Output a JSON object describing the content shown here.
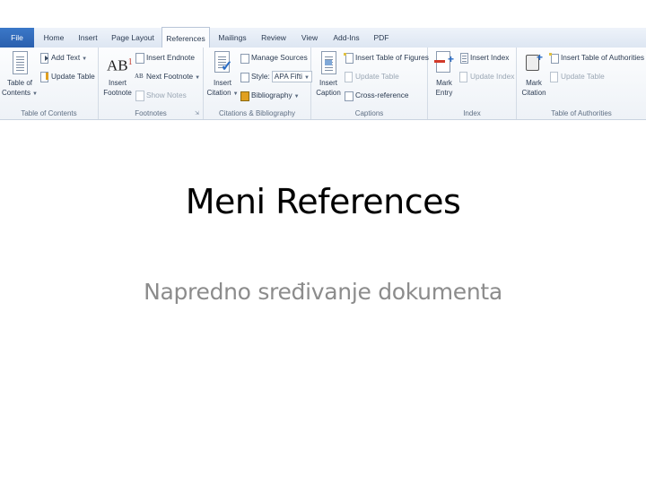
{
  "ribbon": {
    "tabs": [
      "File",
      "Home",
      "Insert",
      "Page Layout",
      "References",
      "Mailings",
      "Review",
      "View",
      "Add-Ins",
      "PDF"
    ],
    "active_tab": "References",
    "groups": {
      "toc": {
        "label": "Table of Contents",
        "big_button": [
          "Table of",
          "Contents"
        ],
        "add_text": "Add Text",
        "update_table": "Update Table"
      },
      "footnotes": {
        "label": "Footnotes",
        "big_button": [
          "Insert",
          "Footnote"
        ],
        "insert_endnote": "Insert Endnote",
        "next_footnote": "Next Footnote",
        "show_notes": "Show Notes"
      },
      "citations": {
        "label": "Citations & Bibliography",
        "big_button": [
          "Insert",
          "Citation"
        ],
        "manage_sources": "Manage Sources",
        "style_label": "Style:",
        "style_value": "APA Fifti",
        "bibliography": "Bibliography"
      },
      "captions": {
        "label": "Captions",
        "big_button": [
          "Insert",
          "Caption"
        ],
        "insert_table_of_figures": "Insert Table of Figures",
        "update_table": "Update Table",
        "cross_reference": "Cross-reference"
      },
      "index": {
        "label": "Index",
        "big_button": [
          "Mark",
          "Entry"
        ],
        "insert_index": "Insert Index",
        "update_index": "Update Index"
      },
      "authorities": {
        "label": "Table of Authorities",
        "big_button": [
          "Mark",
          "Citation"
        ],
        "insert_table_of_authorities": "Insert Table of Authorities",
        "update_table": "Update Table"
      }
    }
  },
  "slide": {
    "title": "Meni References",
    "subtitle": "Napredno sređivanje dokumenta"
  },
  "colors": {
    "file_tab": "#2a5fae",
    "subtitle": "#8c8c8c"
  }
}
